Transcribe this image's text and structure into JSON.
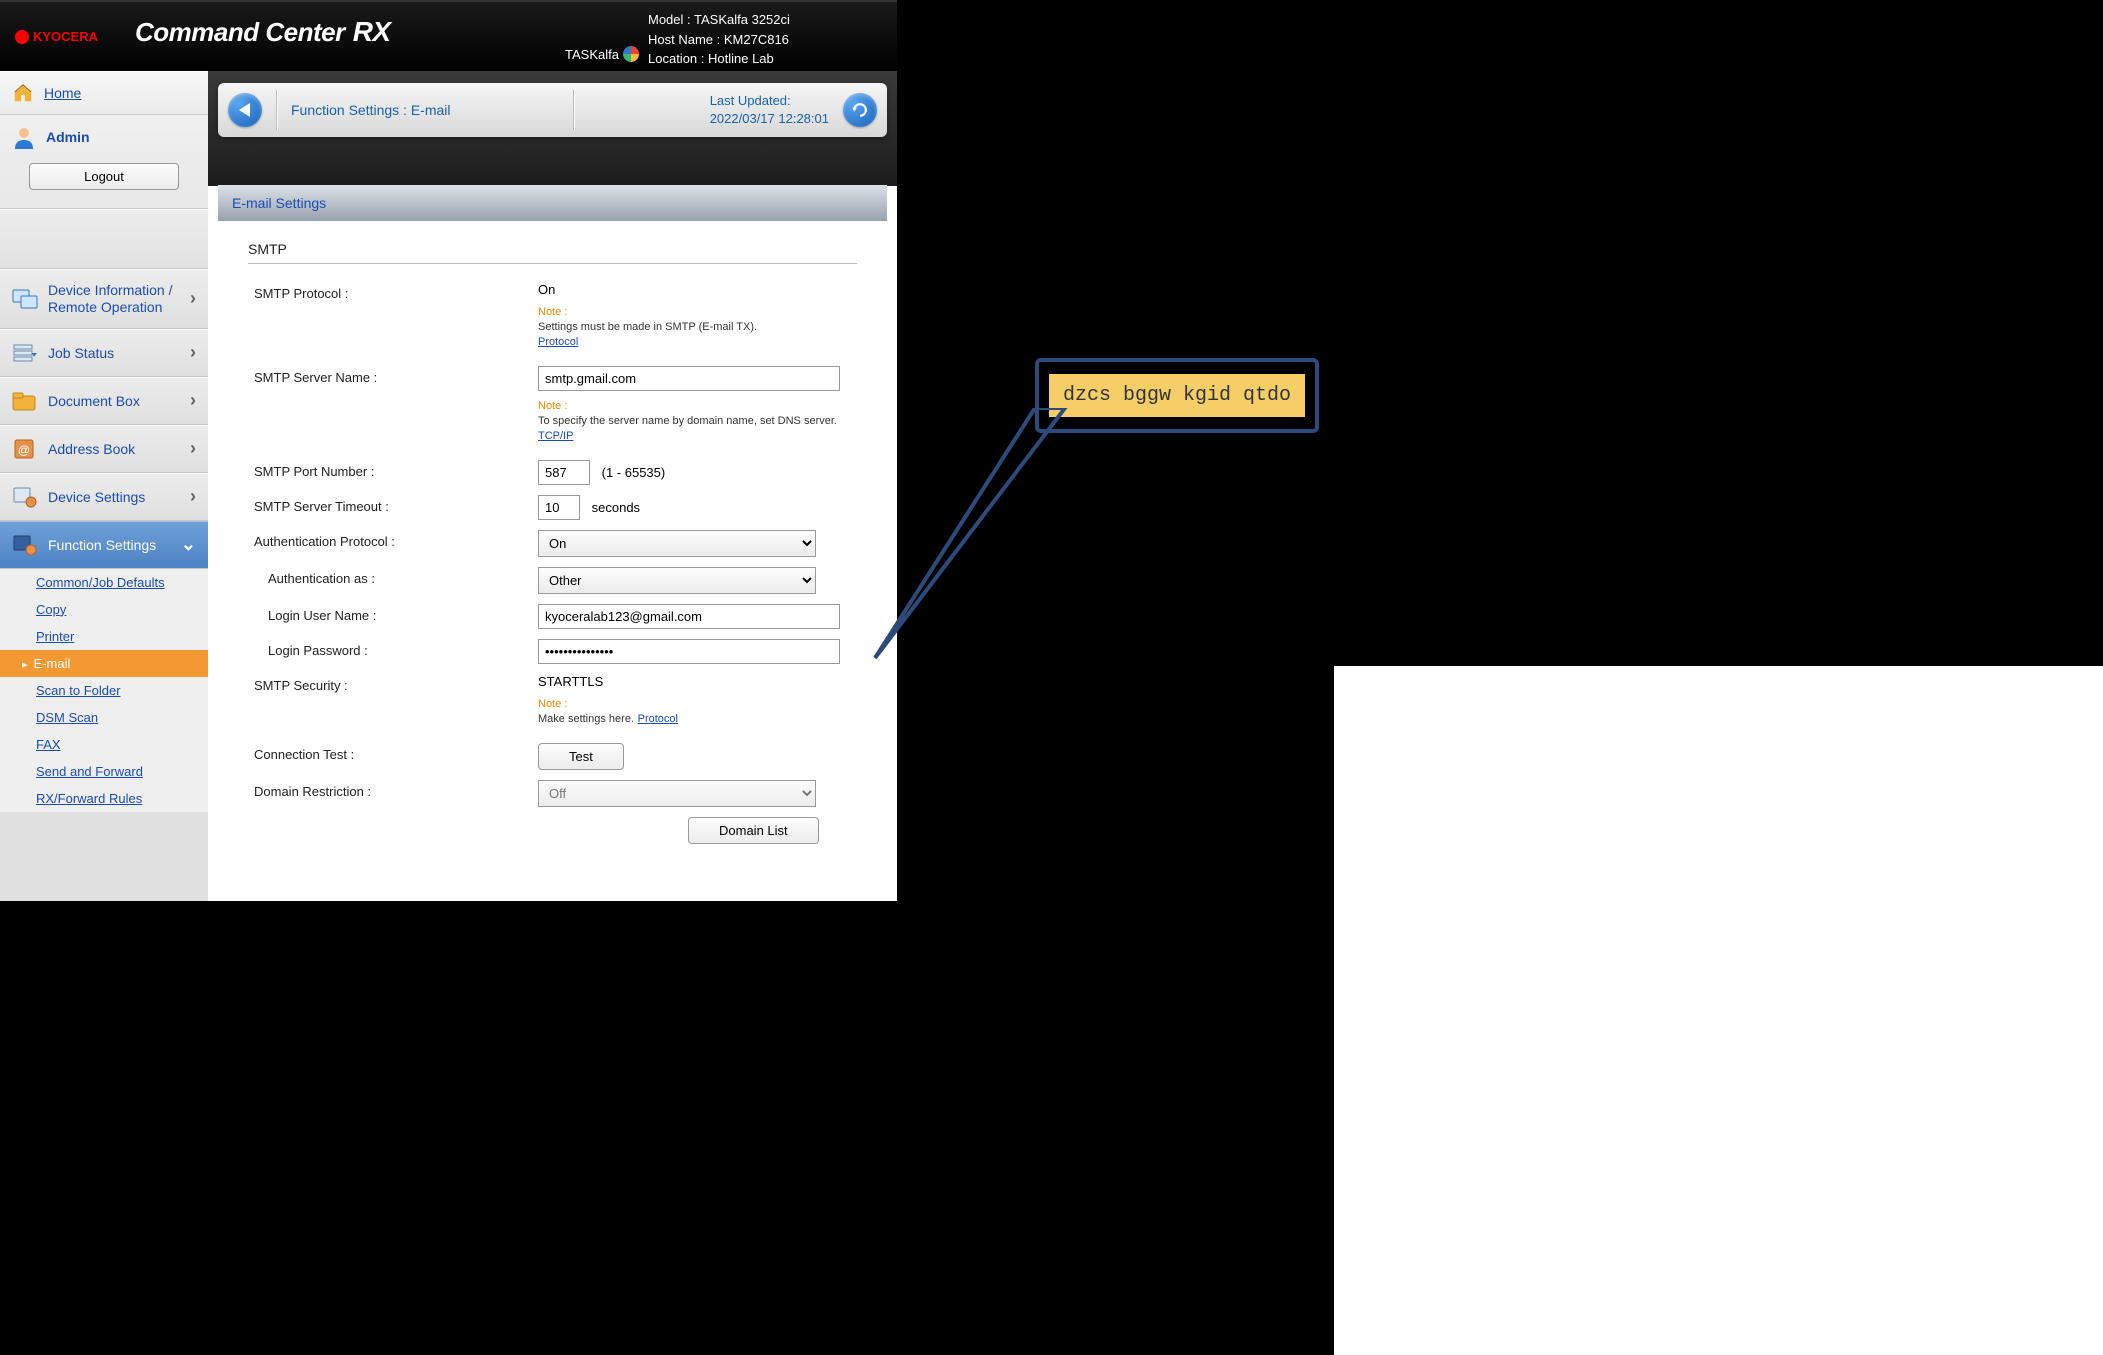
{
  "header": {
    "brand": "KYOCERA",
    "title_a": "Command Center",
    "title_b": "RX",
    "sub_badge": "TASKalfa",
    "model_label": "Model :",
    "model_value": "TASKalfa 3252ci",
    "host_label": "Host Name :",
    "host_value": "KM27C816",
    "location_label": "Location :",
    "location_value": "Hotline Lab"
  },
  "sidebar": {
    "home": "Home",
    "admin": "Admin",
    "logout": "Logout",
    "items": [
      {
        "label": "Device Information / Remote Operation"
      },
      {
        "label": "Job Status"
      },
      {
        "label": "Document Box"
      },
      {
        "label": "Address Book"
      },
      {
        "label": "Device Settings"
      },
      {
        "label": "Function Settings"
      }
    ],
    "subnav": [
      "Common/Job Defaults",
      "Copy",
      "Printer",
      "E-mail",
      "Scan to Folder",
      "DSM Scan",
      "FAX",
      "Send and Forward",
      "RX/Forward Rules"
    ]
  },
  "content_header": {
    "breadcrumb": "Function Settings : E-mail",
    "last_updated_label": "Last Updated:",
    "last_updated_value": "2022/03/17 12:28:01"
  },
  "panel": {
    "title": "E-mail Settings",
    "section": "SMTP",
    "rows": {
      "protocol_label": "SMTP Protocol :",
      "protocol_value": "On",
      "protocol_note_label": "Note :",
      "protocol_note_text": "Settings must be made in SMTP (E-mail TX).",
      "protocol_note_link": "Protocol",
      "server_label": "SMTP Server Name :",
      "server_value": "smtp.gmail.com",
      "server_note_label": "Note :",
      "server_note_text": "To specify the server name by domain name, set DNS server.",
      "server_note_link": "TCP/IP",
      "port_label": "SMTP Port Number :",
      "port_value": "587",
      "port_range": "(1 - 65535)",
      "timeout_label": "SMTP Server Timeout :",
      "timeout_value": "10",
      "timeout_unit": "seconds",
      "auth_label": "Authentication Protocol :",
      "auth_value": "On",
      "auth_as_label": "Authentication as :",
      "auth_as_value": "Other",
      "login_user_label": "Login User Name :",
      "login_user_value": "kyoceralab123@gmail.com",
      "login_pass_label": "Login Password :",
      "login_pass_value": "•••••••••••••••",
      "security_label": "SMTP Security :",
      "security_value": "STARTTLS",
      "security_note_label": "Note :",
      "security_note_text": "Make settings here.",
      "security_note_link": "Protocol",
      "conn_test_label": "Connection Test :",
      "conn_test_btn": "Test",
      "domain_restrict_label": "Domain Restriction :",
      "domain_restrict_value": "Off",
      "domain_list_btn": "Domain List"
    }
  },
  "annotation": {
    "password_reveal": "dzcs bggw kgid qtdo"
  }
}
